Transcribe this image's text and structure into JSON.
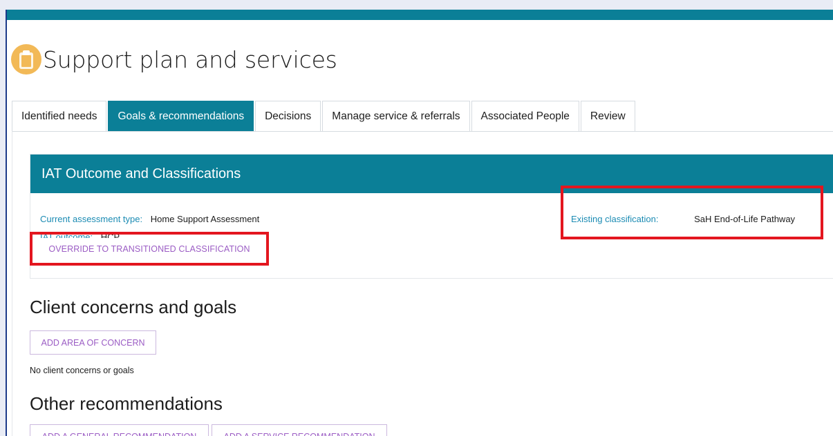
{
  "page": {
    "title": "Support plan and services",
    "icon": "clipboard-icon",
    "accent_color": "#0b7f97",
    "link_color": "#9b5cc4",
    "highlight_color": "#e3161f"
  },
  "tabs": [
    {
      "label": "Identified needs",
      "active": false
    },
    {
      "label": "Goals & recommendations",
      "active": true
    },
    {
      "label": "Decisions",
      "active": false
    },
    {
      "label": "Manage service & referrals",
      "active": false
    },
    {
      "label": "Associated People",
      "active": false
    },
    {
      "label": "Review",
      "active": false
    }
  ],
  "iat_panel": {
    "title": "IAT Outcome and Classifications",
    "assessment_type_label": "Current assessment type:",
    "assessment_type_value": "Home Support Assessment",
    "outcome_label": "IAT outcome:",
    "outcome_value": "HCP",
    "override_button": "OVERRIDE TO TRANSITIONED CLASSIFICATION",
    "existing_classification_label": "Existing classification:",
    "existing_classification_value": "SaH End-of-Life Pathway"
  },
  "concerns": {
    "heading": "Client concerns and goals",
    "add_button": "ADD AREA OF CONCERN",
    "empty_text": "No client concerns or goals"
  },
  "recommendations": {
    "heading": "Other recommendations",
    "add_general_button": "ADD A GENERAL RECOMMENDATION",
    "add_service_button": "ADD A SERVICE RECOMMENDATION"
  }
}
